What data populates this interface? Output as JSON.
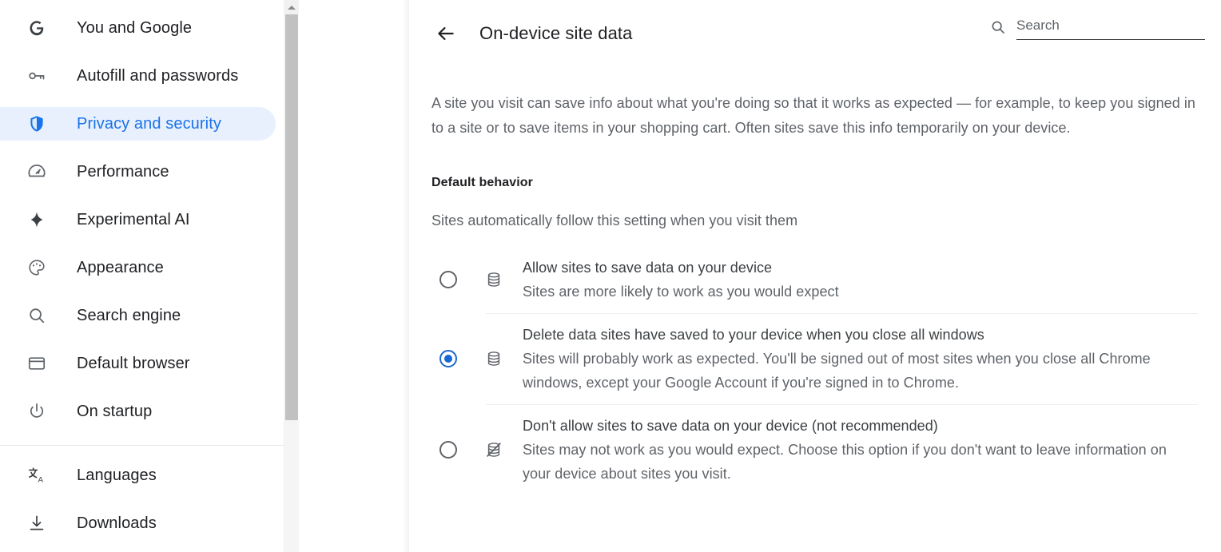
{
  "sidebar": {
    "groups": [
      {
        "items": [
          {
            "label": "You and Google",
            "icon": "google-g-icon",
            "selected": false
          },
          {
            "label": "Autofill and passwords",
            "icon": "key-icon",
            "selected": false
          },
          {
            "label": "Privacy and security",
            "icon": "shield-icon",
            "selected": true
          },
          {
            "label": "Performance",
            "icon": "speedometer-icon",
            "selected": false
          },
          {
            "label": "Experimental AI",
            "icon": "sparkle-icon",
            "selected": false
          },
          {
            "label": "Appearance",
            "icon": "palette-icon",
            "selected": false
          },
          {
            "label": "Search engine",
            "icon": "search-icon",
            "selected": false
          },
          {
            "label": "Default browser",
            "icon": "browser-icon",
            "selected": false
          },
          {
            "label": "On startup",
            "icon": "power-icon",
            "selected": false
          }
        ]
      },
      {
        "items": [
          {
            "label": "Languages",
            "icon": "translate-icon",
            "selected": false
          },
          {
            "label": "Downloads",
            "icon": "download-icon",
            "selected": false
          }
        ]
      }
    ]
  },
  "header": {
    "back_label": "Back",
    "title": "On-device site data",
    "search_placeholder": "Search",
    "search_value": ""
  },
  "main": {
    "intro": "A site you visit can save info about what you're doing so that it works as expected — for example, to keep you signed in to a site or to save items in your shopping cart. Often sites save this info temporarily on your device.",
    "section_title": "Default behavior",
    "section_subtitle": "Sites automatically follow this setting when you visit them",
    "options": [
      {
        "id": "allow",
        "icon": "database-icon",
        "title": "Allow sites to save data on your device",
        "description": "Sites are more likely to work as you would expect",
        "checked": false
      },
      {
        "id": "delete-on-close",
        "icon": "database-icon",
        "title": "Delete data sites have saved to your device when you close all windows",
        "description": "Sites will probably work as expected. You'll be signed out of most sites when you close all Chrome windows, except your Google Account if you're signed in to Chrome.",
        "checked": true
      },
      {
        "id": "block",
        "icon": "database-off-icon",
        "title": "Don't allow sites to save data on your device (not recommended)",
        "description": "Sites may not work as you would expect. Choose this option if you don't want to leave information on your device about sites you visit.",
        "checked": false
      }
    ]
  },
  "colors": {
    "accent": "#1a73e8",
    "selected_radio": "#1967d2",
    "selected_nav_bg": "#e8f0fe",
    "text_primary": "#202124",
    "text_secondary": "#5f6368",
    "scrollbar_thumb": "#c1c1c1"
  }
}
